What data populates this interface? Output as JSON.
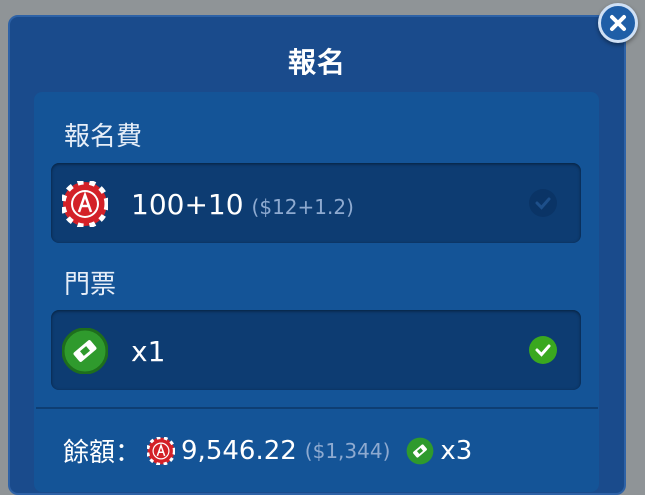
{
  "dialog": {
    "title": "報名",
    "fee_label": "報名費",
    "fee_main": "100+10",
    "fee_sub": "($12+1.2)",
    "ticket_label": "門票",
    "ticket_count": "x1",
    "balance_label": "餘額：",
    "balance_amount": "9,546.22",
    "balance_usd": "($1,344)",
    "balance_tickets": "x3"
  },
  "colors": {
    "background": "#1a4b8c",
    "row": "#0d3c72",
    "check_on": "#3aa81f",
    "chip_red": "#d32128",
    "ticket_green": "#2f9a2d"
  },
  "icons": [
    "close-icon",
    "chip-icon",
    "ticket-icon",
    "check-icon"
  ]
}
